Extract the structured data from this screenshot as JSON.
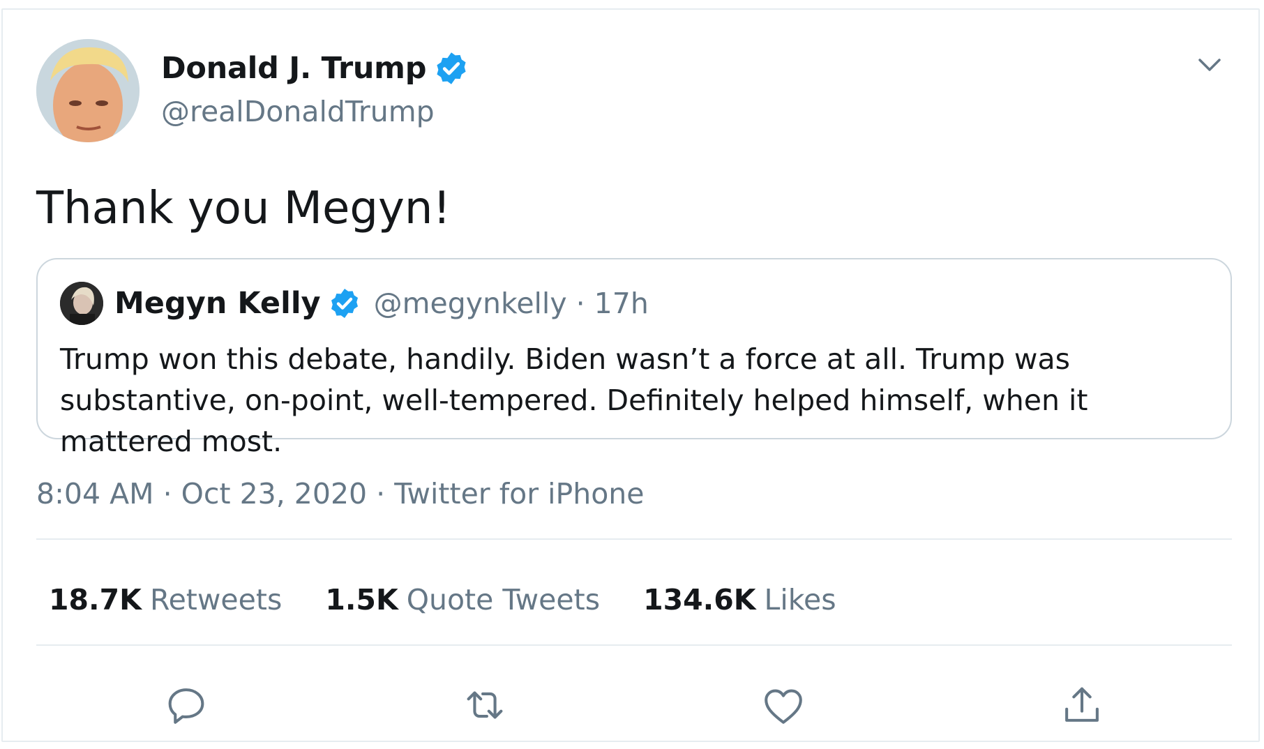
{
  "author": {
    "name": "Donald J. Trump",
    "handle": "@realDonaldTrump",
    "verified_icon": "verified-badge-icon"
  },
  "tweet": {
    "text": "Thank you Megyn!"
  },
  "quoted_tweet": {
    "name": "Megyn Kelly",
    "handle_time": "@megynkelly · 17h",
    "text": "Trump won this debate, handily. Biden wasn’t a force at all. Trump was substantive, on-point, well-tempered. Definitely helped himself, when it mattered most."
  },
  "meta": {
    "time": "8:04 AM",
    "sep1": " · ",
    "date": "Oct 23, 2020",
    "sep2": " · ",
    "source": "Twitter for iPhone"
  },
  "stats": [
    {
      "count": "18.7K",
      "label": "Retweets"
    },
    {
      "count": "1.5K",
      "label": "Quote Tweets"
    },
    {
      "count": "134.6K",
      "label": "Likes"
    }
  ],
  "actions": [
    "reply-icon",
    "retweet-icon",
    "like-icon",
    "share-icon"
  ],
  "colors": {
    "verified": "#1da1f2",
    "secondary_text": "#657786",
    "border": "#e6ecf0"
  }
}
